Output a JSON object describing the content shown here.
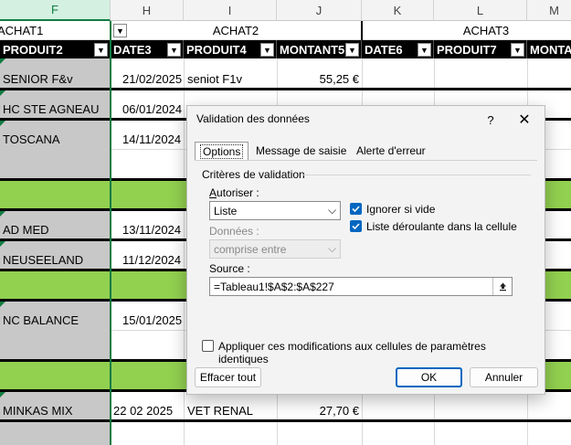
{
  "columns": {
    "F": "F",
    "H": "H",
    "I": "I",
    "J": "J",
    "K": "K",
    "L": "L",
    "M": "M"
  },
  "groups": {
    "g1": "ACHAT1",
    "g2": "ACHAT2",
    "g3": "ACHAT3"
  },
  "table_headers": [
    "PRODUIT2",
    "DATE3",
    "PRODUIT4",
    "MONTANT5",
    "DATE6",
    "PRODUIT7",
    "MONTA"
  ],
  "rows": [
    {
      "produit2": "SENIOR F&v",
      "date3": "21/02/2025",
      "produit4": "seniot F1v",
      "montant5": "55,25 €"
    },
    {
      "produit2": "HC STE AGNEAU",
      "date3": "06/01/2024",
      "produit4": "",
      "montant5": ""
    },
    {
      "produit2": "TOSCANA",
      "date3": "14/11/2024",
      "produit4": "",
      "montant5": ""
    },
    {
      "produit2": "AD MED",
      "date3": "13/11/2024",
      "produit4": "",
      "montant5": ""
    },
    {
      "produit2": "NEUSEELAND",
      "date3": "11/12/2024",
      "produit4": "",
      "montant5": ""
    },
    {
      "produit2": "NC BALANCE",
      "date3": "15/01/2025",
      "produit4": "",
      "montant5": ""
    },
    {
      "produit2": "MINKAS MIX",
      "date3": "22 02 2025",
      "produit4": "VET RENAL",
      "montant5": "27,70 €"
    }
  ],
  "dialog": {
    "title": "Validation des données",
    "help": "?",
    "close": "✕",
    "tabs": [
      "Options",
      "Message de saisie",
      "Alerte d'erreur"
    ],
    "section": "Critères de validation",
    "autoriser_label": "Autoriser :",
    "autoriser_value": "Liste",
    "donnees_label": "Données :",
    "donnees_value": "comprise entre",
    "ignore_blank": "Ignorer si vide",
    "dropdown_in_cell": "Liste déroulante dans la cellule",
    "source_label": "Source :",
    "source_value": "=Tableau1!$A$2:$A$227",
    "apply_all": "Appliquer ces modifications aux cellules de paramètres identiques",
    "clear_all": "Effacer tout",
    "ok": "OK",
    "cancel": "Annuler"
  },
  "icons": {
    "dropdown": "chevron-down-icon",
    "collapse": "collapse-dialog-icon"
  },
  "colors": {
    "accent": "#0067c0",
    "green_row": "#92d050",
    "excel_green": "#107c41"
  }
}
